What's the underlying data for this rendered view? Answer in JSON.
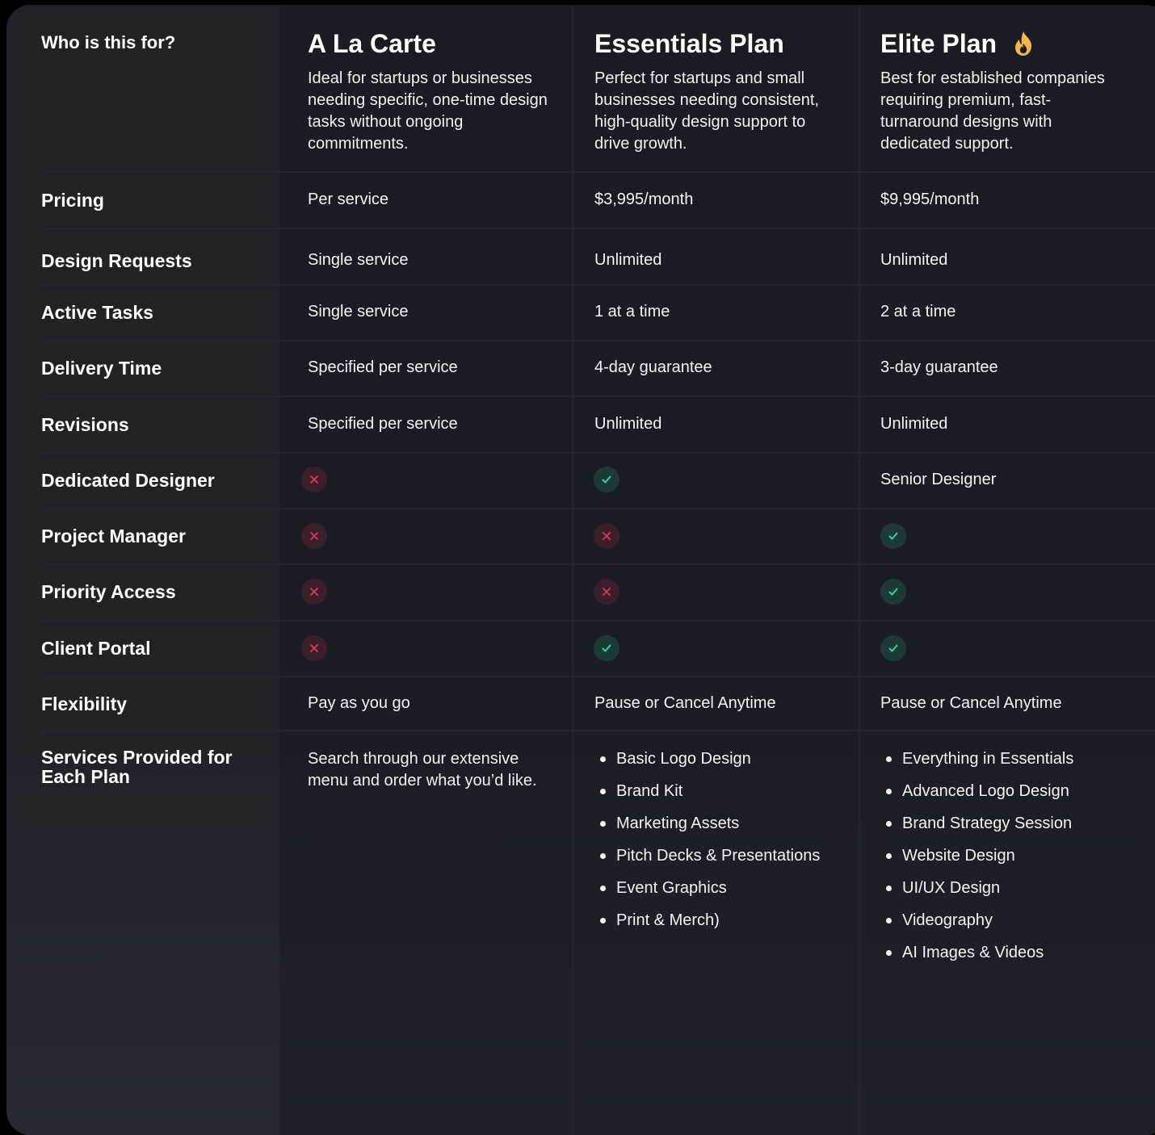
{
  "header": {
    "who_label": "Who is this for?",
    "plans": [
      {
        "name": "A La Carte",
        "description": "Ideal for startups or businesses needing specific, one-time design tasks without ongoing commitments."
      },
      {
        "name": "Essentials Plan",
        "description": "Perfect for startups and small businesses needing consistent, high-quality design support to drive growth."
      },
      {
        "name": "Elite Plan",
        "description": "Best for established companies requiring premium, fast-turnaround designs with dedicated support.",
        "badge_icon": "fire-icon"
      }
    ]
  },
  "rows": {
    "pricing": {
      "label": "Pricing",
      "values": [
        "Per service",
        "$3,995/month",
        "$9,995/month"
      ]
    },
    "design_requests": {
      "label": "Design Requests",
      "values": [
        "Single service",
        "Unlimited",
        "Unlimited"
      ]
    },
    "active_tasks": {
      "label": "Active Tasks",
      "values": [
        "Single service",
        "1 at a time",
        "2 at a time"
      ]
    },
    "delivery_time": {
      "label": "Delivery Time",
      "values": [
        "Specified per service",
        "4-day guarantee",
        "3-day guarantee"
      ]
    },
    "revisions": {
      "label": "Revisions",
      "values": [
        "Specified per service",
        "Unlimited",
        "Unlimited"
      ]
    },
    "dedicated_designer": {
      "label": "Dedicated Designer",
      "values": [
        "no",
        "yes",
        "Senior Designer"
      ]
    },
    "project_manager": {
      "label": "Project Manager",
      "values": [
        "no",
        "no",
        "yes"
      ]
    },
    "priority_access": {
      "label": "Priority Access",
      "values": [
        "no",
        "no",
        "yes"
      ]
    },
    "client_portal": {
      "label": "Client Portal",
      "values": [
        "no",
        "yes",
        "yes"
      ]
    },
    "flexibility": {
      "label": "Flexibility",
      "values": [
        "Pay as you go",
        "Pause or Cancel Anytime",
        "Pause or Cancel Anytime"
      ]
    }
  },
  "services": {
    "label": "Services Provided for Each Plan",
    "a_la_carte": "Search through our extensive menu and order what you’d like.",
    "essentials": [
      "Basic Logo Design",
      "Brand Kit",
      "Marketing Assets",
      "Pitch Decks & Presentations",
      "Event Graphics",
      "Print & Merch)"
    ],
    "elite": [
      "Everything in Essentials",
      "Advanced Logo Design",
      "Brand Strategy Session",
      "Website Design",
      "UI/UX Design",
      "Videography",
      "AI Images & Videos"
    ]
  },
  "colors": {
    "background": "#1b1c23",
    "label_column": "#212228",
    "check": "#2ed3a6",
    "cross": "#e0355c",
    "fire": "#f4b54a"
  }
}
